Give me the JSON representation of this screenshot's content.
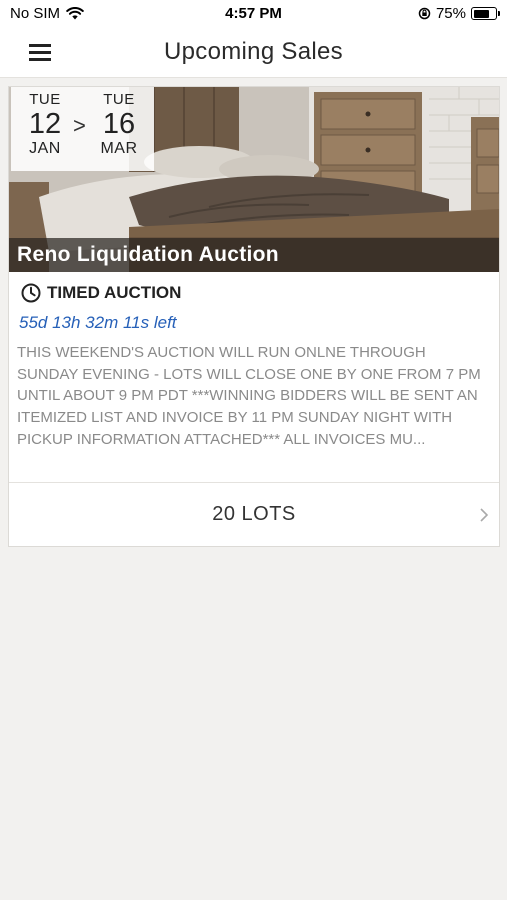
{
  "status_bar": {
    "carrier": "No SIM",
    "time": "4:57 PM",
    "battery_percent": "75%",
    "battery_level": 0.75,
    "icons": [
      "wifi-icon",
      "orientation-lock-icon",
      "battery-icon"
    ]
  },
  "nav": {
    "title": "Upcoming Sales",
    "menu_icon": "hamburger-menu-icon"
  },
  "sale": {
    "start": {
      "dow": "TUE",
      "day": "12",
      "month": "JAN"
    },
    "arrow": ">",
    "end": {
      "dow": "TUE",
      "day": "16",
      "month": "MAR"
    },
    "title": "Reno Liquidation Auction",
    "type_icon": "clock-icon",
    "type": "TIMED AUCTION",
    "time_left": "55d 13h 32m 11s left",
    "description": "THIS WEEKEND'S AUCTION WILL RUN ONLNE THROUGH SUNDAY EVENING - LOTS WILL CLOSE ONE BY ONE FROM 7 PM UNTIL ABOUT 9 PM PDT ***WINNING BIDDERS WILL BE SENT AN ITEMIZED LIST AND INVOICE BY 11 PM SUNDAY NIGHT WITH PICKUP INFORMATION ATTACHED*** ALL INVOICES MU...",
    "lots_label": "20 LOTS",
    "lots_icon": "chevron-right-icon"
  },
  "colors": {
    "background": "#f2f1ef",
    "link_blue": "#2660b8",
    "description_gray": "#8a8a8a"
  }
}
